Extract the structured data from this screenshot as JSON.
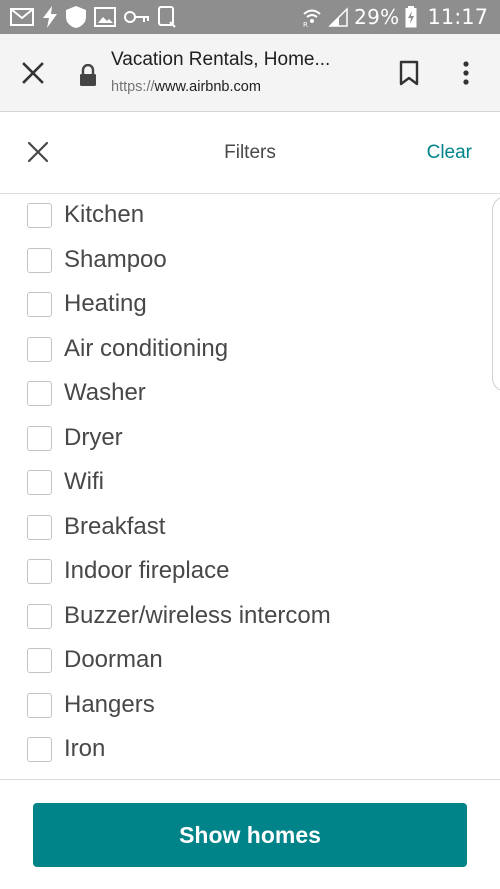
{
  "status_bar": {
    "icons": [
      "mail-icon",
      "flash-icon",
      "shield-icon",
      "image-icon",
      "key-icon",
      "cast-icon",
      "wifi-icon",
      "signal-icon",
      "battery-charging-icon"
    ],
    "battery": "29%",
    "time": "11:17"
  },
  "browser": {
    "page_title": "Vacation Rentals, Home...",
    "url_scheme": "https://",
    "url_host": "www.airbnb.com"
  },
  "filters": {
    "title": "Filters",
    "clear_label": "Clear",
    "amenities": [
      {
        "label": "Kitchen",
        "checked": false
      },
      {
        "label": "Shampoo",
        "checked": false
      },
      {
        "label": "Heating",
        "checked": false
      },
      {
        "label": "Air conditioning",
        "checked": false
      },
      {
        "label": "Washer",
        "checked": false
      },
      {
        "label": "Dryer",
        "checked": false
      },
      {
        "label": "Wifi",
        "checked": false
      },
      {
        "label": "Breakfast",
        "checked": false
      },
      {
        "label": "Indoor fireplace",
        "checked": false
      },
      {
        "label": "Buzzer/wireless intercom",
        "checked": false
      },
      {
        "label": "Doorman",
        "checked": false
      },
      {
        "label": "Hangers",
        "checked": false
      },
      {
        "label": "Iron",
        "checked": false
      }
    ]
  },
  "footer": {
    "show_button_label": "Show homes"
  },
  "colors": {
    "accent": "#008489",
    "status_bar": "#8e8e8e",
    "text": "#484848"
  }
}
